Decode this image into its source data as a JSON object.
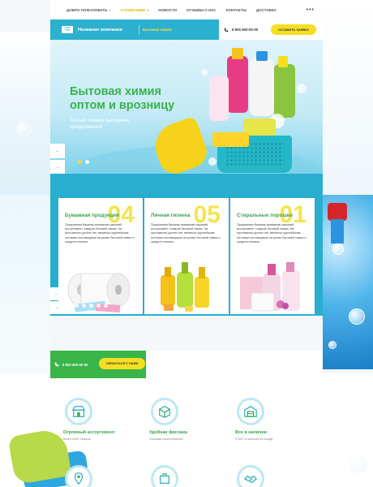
{
  "topnav": {
    "items": [
      {
        "label": "ДОБРО ПОЖАЛОВАТЬ",
        "has_chevron": true,
        "active": false
      },
      {
        "label": "О КОМПАНИИ",
        "has_chevron": true,
        "active": true
      },
      {
        "label": "НОВОСТИ",
        "has_chevron": false,
        "active": false
      },
      {
        "label": "ОТЗЫВЫ О НАС",
        "has_chevron": false,
        "active": false
      },
      {
        "label": "КОНТАКТЫ",
        "has_chevron": false,
        "active": false
      },
      {
        "label": "ДОСТАВКА",
        "has_chevron": false,
        "active": false
      }
    ],
    "more": "•••"
  },
  "header": {
    "logo_text": "LOGO TYPE",
    "company_name": "Название компании",
    "tagline": "Бытовая химия",
    "phone": "8 800 600-00-00",
    "cta_label": "ОСТАВИТЬ ЗАЯВКУ"
  },
  "hero": {
    "title_line1": "Бытовая химия",
    "title_line2": "оптом и врозницу",
    "subtitle_line1": "Только самые выгодные",
    "subtitle_line2": "предложения",
    "prev": "←",
    "next": "→"
  },
  "features": {
    "cards": [
      {
        "number": "04",
        "title": "Бумажная продукция",
        "desc": "Предлагаем Вашему вниманию широкий ассортимент товаров бытовой химии. На протяжении долгих лет является крупнейшим оптовым поставщиком на рынке бытовой химии и средств гигиены."
      },
      {
        "number": "05",
        "title": "Личная гигиена",
        "desc": "Предлагаем Вашему вниманию широкий ассортимент товаров бытовой химии. На протяжении долгих лет является крупнейшим оптовым поставщиком на рынке бытовой химии и средств гигиены."
      },
      {
        "number": "01",
        "title": "Стиральные порошки",
        "desc": "Предлагаем Вашему вниманию широкий ассортимент товаров бытовой химии. На протяжении долгих лет является крупнейшим оптовым поставщиком на рынке бытовой химии и средств гигиены."
      }
    ],
    "prev": "←",
    "next": "→"
  },
  "callbar": {
    "phone": "8 800 600-00-00",
    "cta_label": "СВЯЗАТЬСЯ С НАМИ"
  },
  "benefits": [
    {
      "title": "Огромный ассортимент",
      "sub": "Более 6000 товаров",
      "icon": "store-icon"
    },
    {
      "title": "Удобная фасовка",
      "sub": "Упаковка разнообразная",
      "icon": "box-icon"
    },
    {
      "title": "Все в наличии",
      "sub": "4 000+ в наличии на складе",
      "icon": "warehouse-icon"
    }
  ],
  "benefits_row2_icons": [
    "location-icon",
    "package-icon",
    "handshake-icon"
  ],
  "colors": {
    "accent_blue": "#2cb0cf",
    "accent_yellow": "#f6df23",
    "accent_green": "#39b54a"
  }
}
